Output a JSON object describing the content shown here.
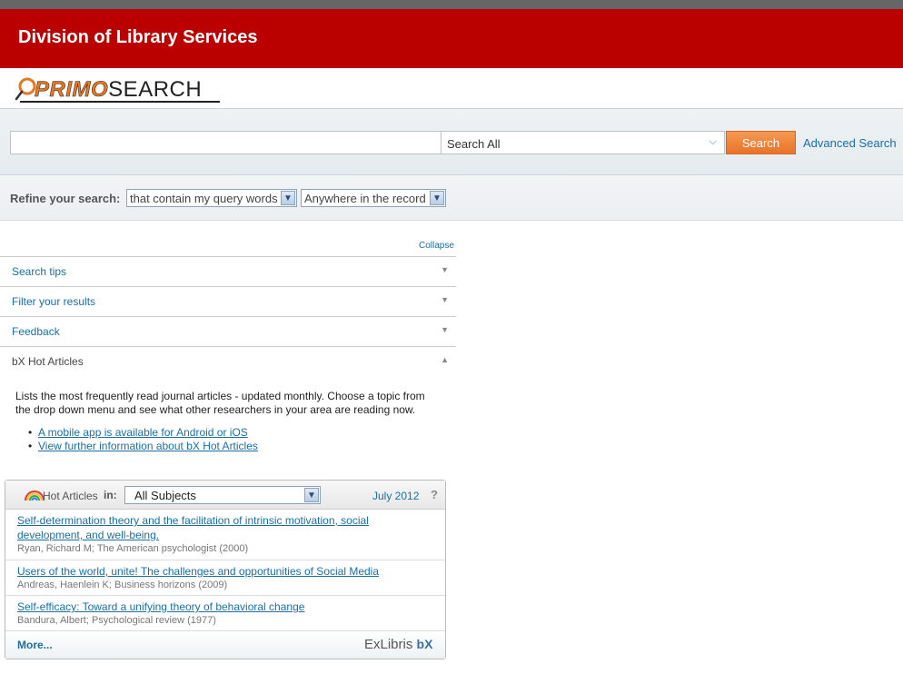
{
  "banner": {
    "title": "Division of Library Services"
  },
  "logo": {
    "primo": "PRIMO",
    "search": "SEARCH"
  },
  "search": {
    "query": "",
    "scope_selected": "Search All",
    "button_label": "Search",
    "advanced_label": "Advanced Search"
  },
  "refine": {
    "label": "Refine your search:",
    "match_selected": "that contain my query words",
    "field_selected": "Anywhere in the record"
  },
  "sidebar": {
    "collapse_label": "Collapse",
    "items": [
      {
        "label": "Search tips",
        "state": "collapsed"
      },
      {
        "label": "Filter your results",
        "state": "collapsed"
      },
      {
        "label": "Feedback",
        "state": "collapsed"
      },
      {
        "label": "bX Hot Articles",
        "state": "expanded"
      }
    ]
  },
  "bx": {
    "description": "Lists the most frequently read journal articles - updated monthly. Choose a topic from the drop down menu and see what other researchers in your area are reading now.",
    "links": [
      "A mobile app is available for Android or iOS",
      "View further information about bX Hot Articles"
    ]
  },
  "widget": {
    "title": "Hot Articles",
    "in_label": "in:",
    "subject_selected": "All Subjects",
    "date": "July 2012",
    "help": "?",
    "articles": [
      {
        "title": "Self-determination theory and the facilitation of intrinsic motivation, social development, and well-being.",
        "meta": "Ryan, Richard M; The American psychologist (2000)"
      },
      {
        "title": "Users of the world, unite! The challenges and opportunities of Social Media",
        "meta": "Andreas, Haenlein K; Business horizons (2009)"
      },
      {
        "title": "Self-efficacy: Toward a unifying theory of behavioral change",
        "meta": "Bandura, Albert; Psychological review (1977)"
      }
    ],
    "more_label": "More...",
    "brand": "ExLibris",
    "brand_suffix": "bX"
  },
  "colors": {
    "banner": "#bb0000",
    "accent": "#e87722",
    "link": "#1a6fa3"
  }
}
